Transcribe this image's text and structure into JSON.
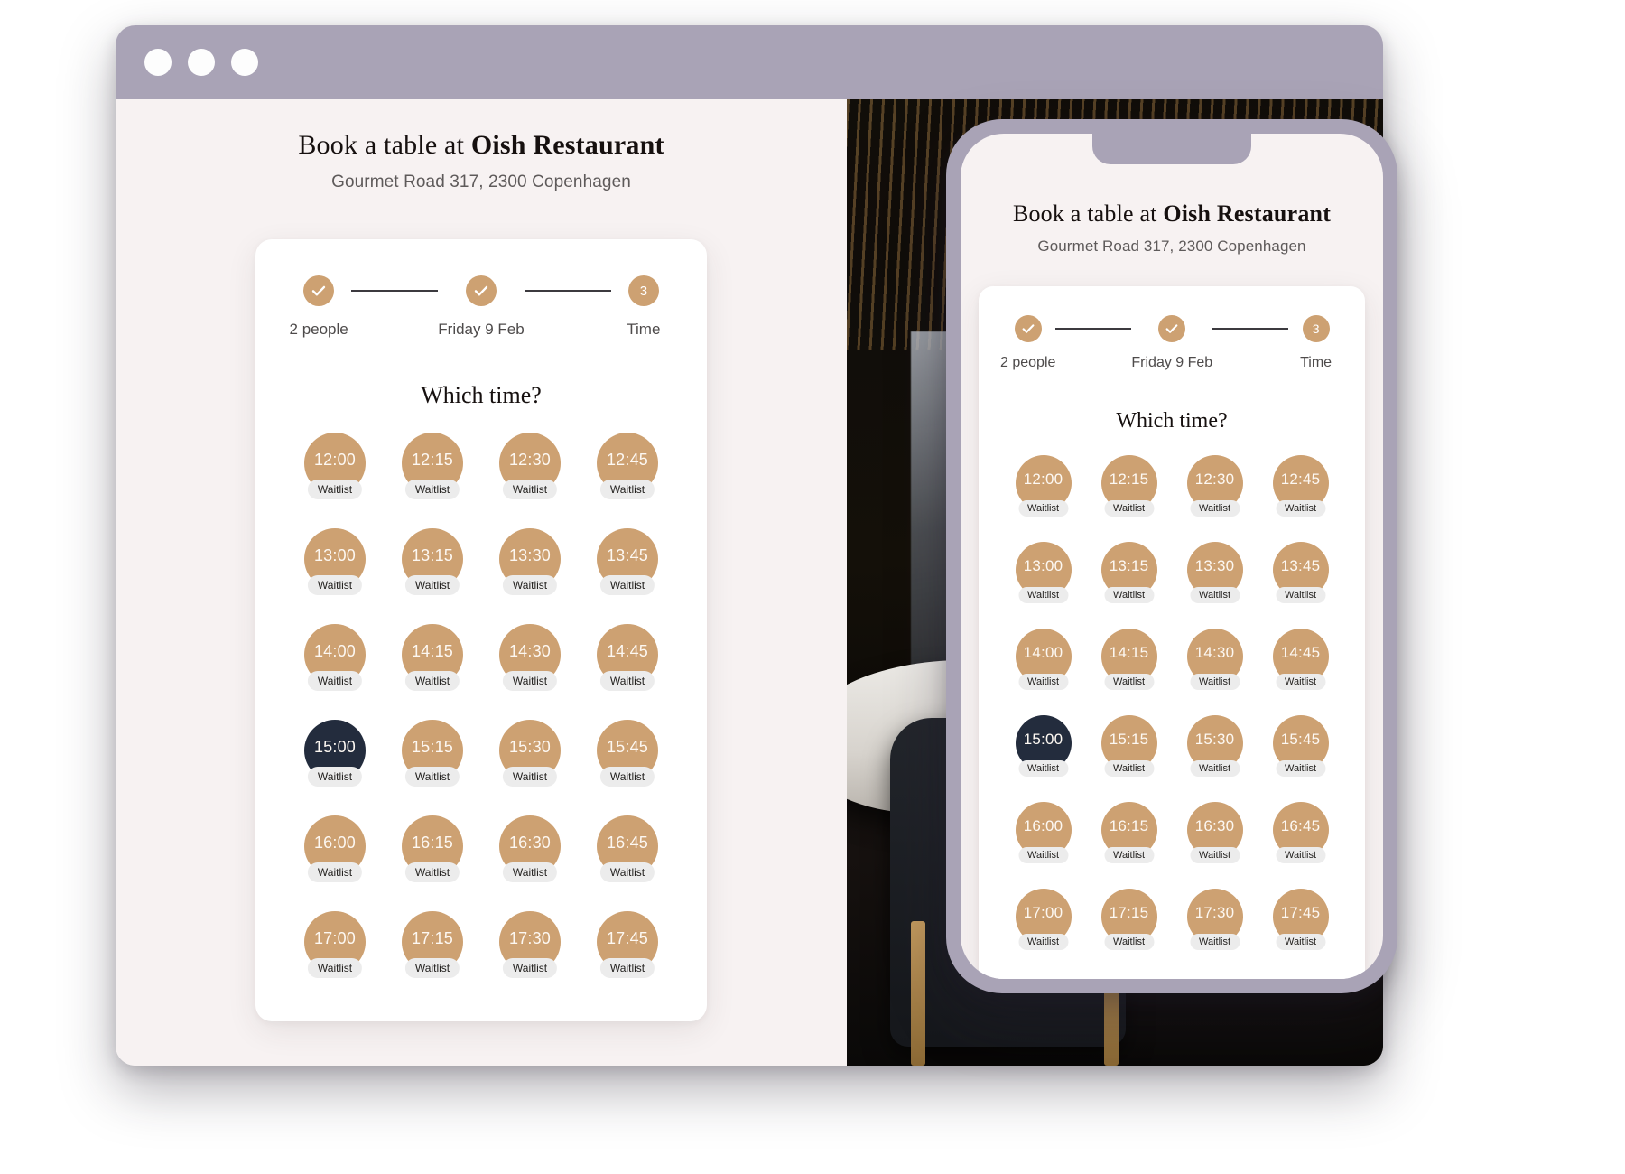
{
  "window": {
    "traffic_lights": [
      "close-dot",
      "minimize-dot",
      "maximize-dot"
    ],
    "chrome_color": "#a9a3b6"
  },
  "colors": {
    "accent": "#cda172",
    "selected": "#232c3d",
    "page_bg": "#f7f2f2",
    "card_bg": "#ffffff",
    "tag_bg": "#ececec",
    "line": "#3c3a3f"
  },
  "booking": {
    "title_prefix": "Book a table at ",
    "title_restaurant": "Oish Restaurant",
    "address": "Gourmet Road 317, 2300 Copenhagen",
    "stepper": {
      "steps": [
        {
          "state": "done",
          "marker": "check-icon",
          "label": "2 people"
        },
        {
          "state": "done",
          "marker": "check-icon",
          "label": "Friday 9 Feb"
        },
        {
          "state": "current",
          "marker": "3",
          "label": "Time"
        }
      ]
    },
    "question": "Which time?",
    "waitlist_label": "Waitlist",
    "selected_time": "15:00",
    "slots": [
      {
        "time": "12:00",
        "tag": "Waitlist",
        "selected": false
      },
      {
        "time": "12:15",
        "tag": "Waitlist",
        "selected": false
      },
      {
        "time": "12:30",
        "tag": "Waitlist",
        "selected": false
      },
      {
        "time": "12:45",
        "tag": "Waitlist",
        "selected": false
      },
      {
        "time": "13:00",
        "tag": "Waitlist",
        "selected": false
      },
      {
        "time": "13:15",
        "tag": "Waitlist",
        "selected": false
      },
      {
        "time": "13:30",
        "tag": "Waitlist",
        "selected": false
      },
      {
        "time": "13:45",
        "tag": "Waitlist",
        "selected": false
      },
      {
        "time": "14:00",
        "tag": "Waitlist",
        "selected": false
      },
      {
        "time": "14:15",
        "tag": "Waitlist",
        "selected": false
      },
      {
        "time": "14:30",
        "tag": "Waitlist",
        "selected": false
      },
      {
        "time": "14:45",
        "tag": "Waitlist",
        "selected": false
      },
      {
        "time": "15:00",
        "tag": "Waitlist",
        "selected": true
      },
      {
        "time": "15:15",
        "tag": "Waitlist",
        "selected": false
      },
      {
        "time": "15:30",
        "tag": "Waitlist",
        "selected": false
      },
      {
        "time": "15:45",
        "tag": "Waitlist",
        "selected": false
      },
      {
        "time": "16:00",
        "tag": "Waitlist",
        "selected": false
      },
      {
        "time": "16:15",
        "tag": "Waitlist",
        "selected": false
      },
      {
        "time": "16:30",
        "tag": "Waitlist",
        "selected": false
      },
      {
        "time": "16:45",
        "tag": "Waitlist",
        "selected": false
      },
      {
        "time": "17:00",
        "tag": "Waitlist",
        "selected": false
      },
      {
        "time": "17:15",
        "tag": "Waitlist",
        "selected": false
      },
      {
        "time": "17:30",
        "tag": "Waitlist",
        "selected": false
      },
      {
        "time": "17:45",
        "tag": "Waitlist",
        "selected": false
      }
    ]
  }
}
